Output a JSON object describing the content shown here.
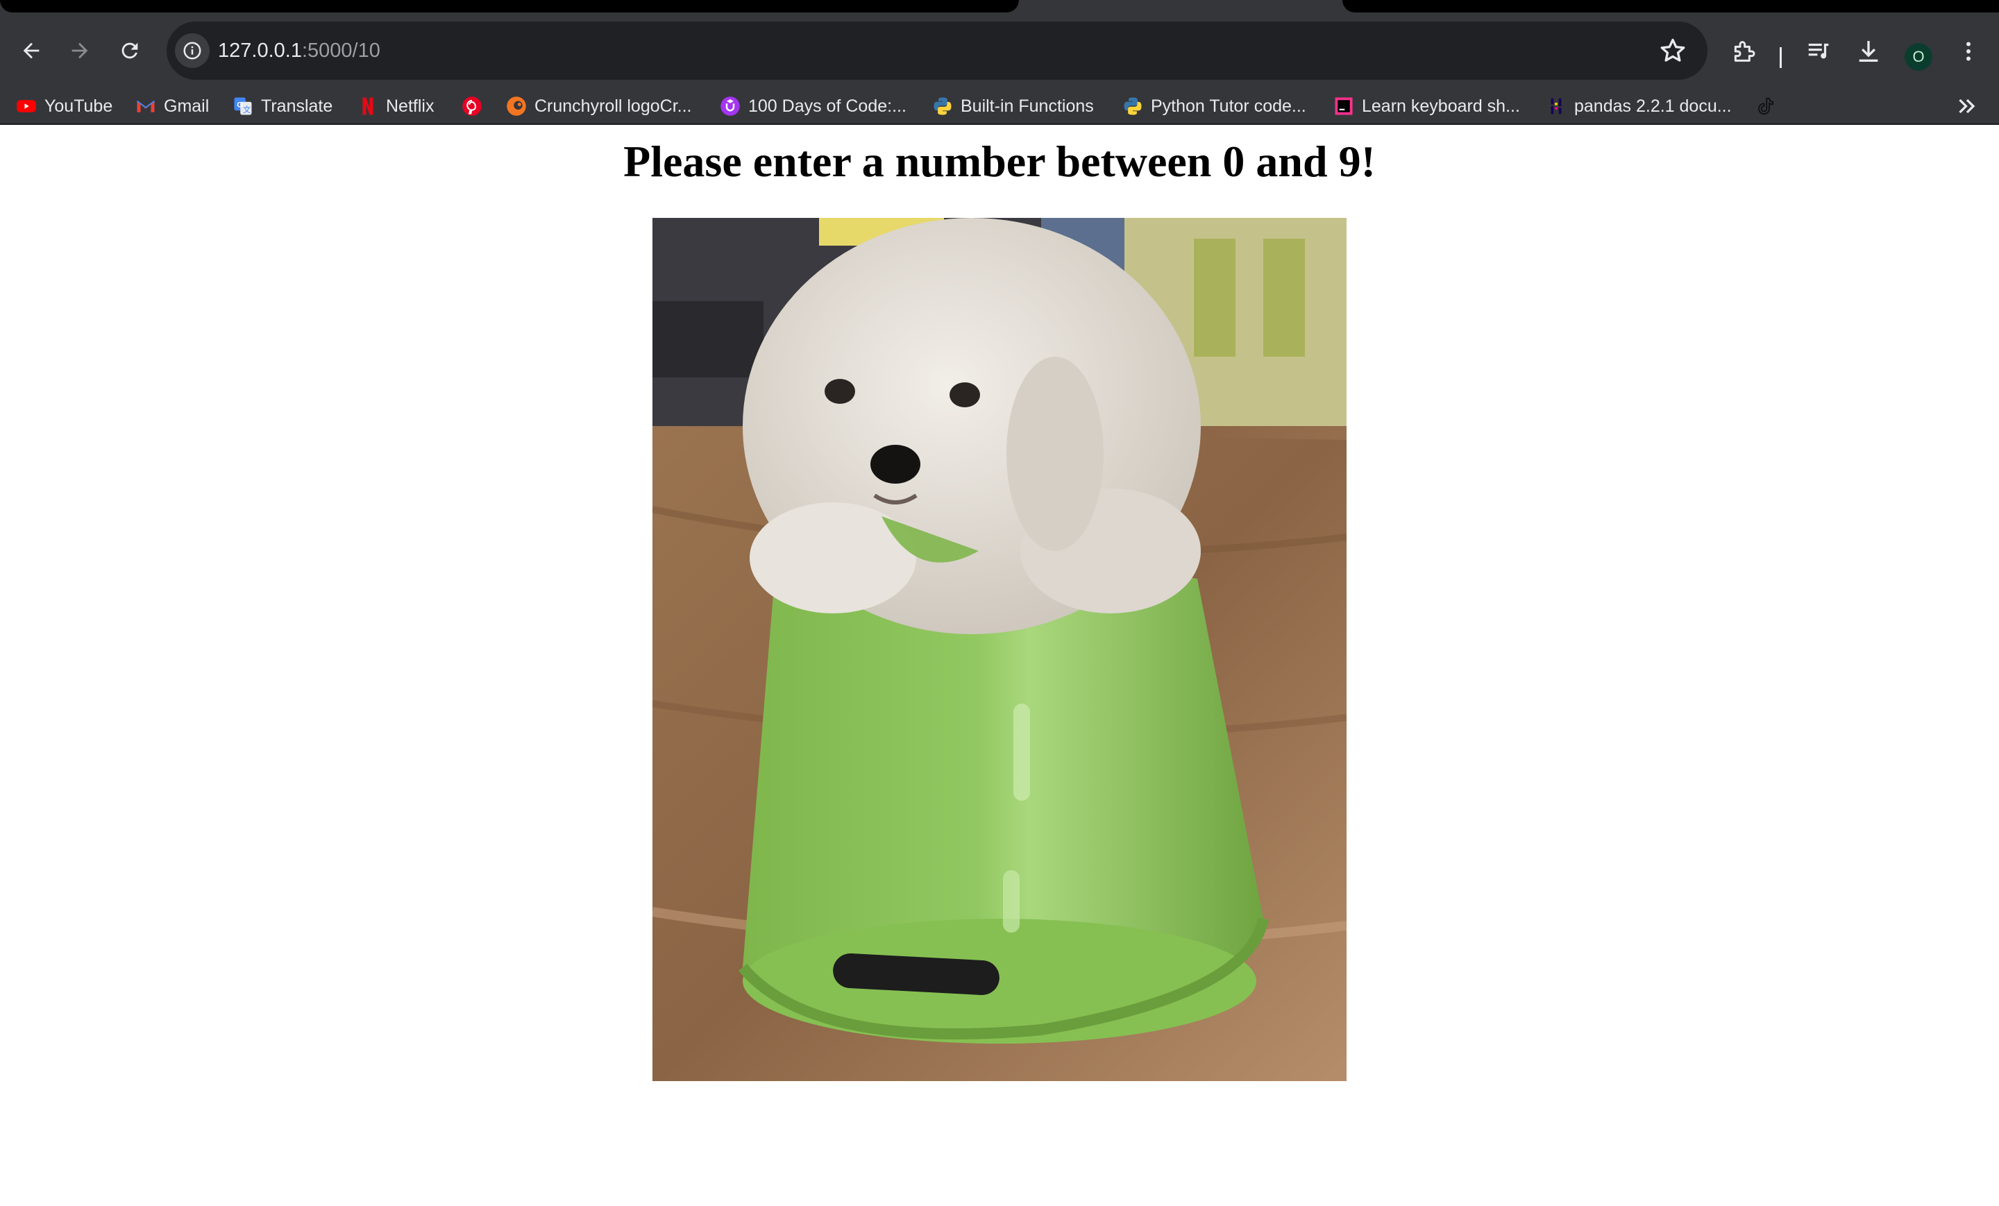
{
  "browser": {
    "url_host": "127.0.0.1",
    "url_path": ":5000/10",
    "profile_initial": "O"
  },
  "bookmarks": [
    {
      "label": "YouTube",
      "icon": "youtube-icon"
    },
    {
      "label": "Gmail",
      "icon": "gmail-icon"
    },
    {
      "label": "Translate",
      "icon": "translate-icon"
    },
    {
      "label": "Netflix",
      "icon": "netflix-icon"
    },
    {
      "label": "",
      "icon": "pinterest-icon"
    },
    {
      "label": "Crunchyroll logoCr...",
      "icon": "crunchyroll-icon"
    },
    {
      "label": "100 Days of Code:...",
      "icon": "udemy-icon"
    },
    {
      "label": "Built-in Functions",
      "icon": "python-icon"
    },
    {
      "label": "Python Tutor code...",
      "icon": "python-icon"
    },
    {
      "label": "Learn keyboard sh...",
      "icon": "jetbrains-icon"
    },
    {
      "label": "pandas 2.2.1 docu...",
      "icon": "pandas-icon"
    },
    {
      "label": "",
      "icon": "tiktok-icon"
    }
  ],
  "page": {
    "heading": "Please enter a number between 0 and 9!",
    "image_subject": "white fluffy puppy sitting on an upside-down green bucket"
  },
  "colors": {
    "chrome": "#35363a",
    "omnibox": "#202124",
    "bucket": "#8cc65a",
    "puppy": "#e6e1da"
  }
}
